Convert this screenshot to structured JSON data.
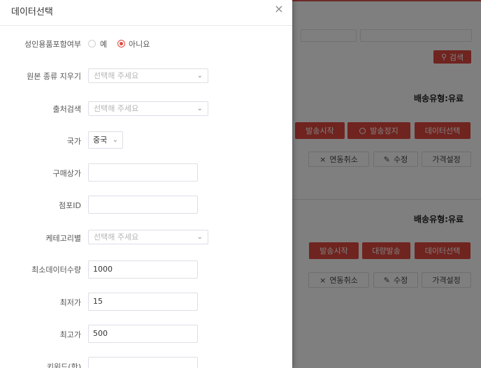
{
  "background": {
    "search_label": "검색",
    "section1": {
      "ship_type": "배송유형:유료",
      "buttons": [
        "발송시작",
        "발송정지",
        "데이터선택"
      ],
      "actions": [
        "연동취소",
        "수정",
        "가격설정"
      ]
    },
    "section2": {
      "ship_type": "배송유형:유료",
      "buttons": [
        "발송시작",
        "대량발송",
        "데이터선택"
      ],
      "actions": [
        "연동취소",
        "수정",
        "가격설정"
      ]
    }
  },
  "drawer": {
    "title": "데이터선택",
    "adult": {
      "label": "성인용품포함여부",
      "options": [
        "예",
        "아니요"
      ],
      "selected": "아니요"
    },
    "original_type": {
      "label": "원본 종류 지우기",
      "placeholder": "선택해 주세요"
    },
    "source_search": {
      "label": "출처검색",
      "placeholder": "선택해 주세요"
    },
    "country": {
      "label": "국가",
      "value": "중국"
    },
    "buyer": {
      "label": "구매상가",
      "value": ""
    },
    "shop_id": {
      "label": "점포ID",
      "value": ""
    },
    "category": {
      "label": "케테고리별",
      "placeholder": "선택해 주세요"
    },
    "min_count": {
      "label": "최소데이터수량",
      "value": "1000"
    },
    "min_price": {
      "label": "최저가",
      "value": "15"
    },
    "max_price": {
      "label": "최고가",
      "value": "500"
    },
    "keyword": {
      "label": "키워드(한)"
    }
  },
  "colors": {
    "accent": "#e0493f"
  }
}
